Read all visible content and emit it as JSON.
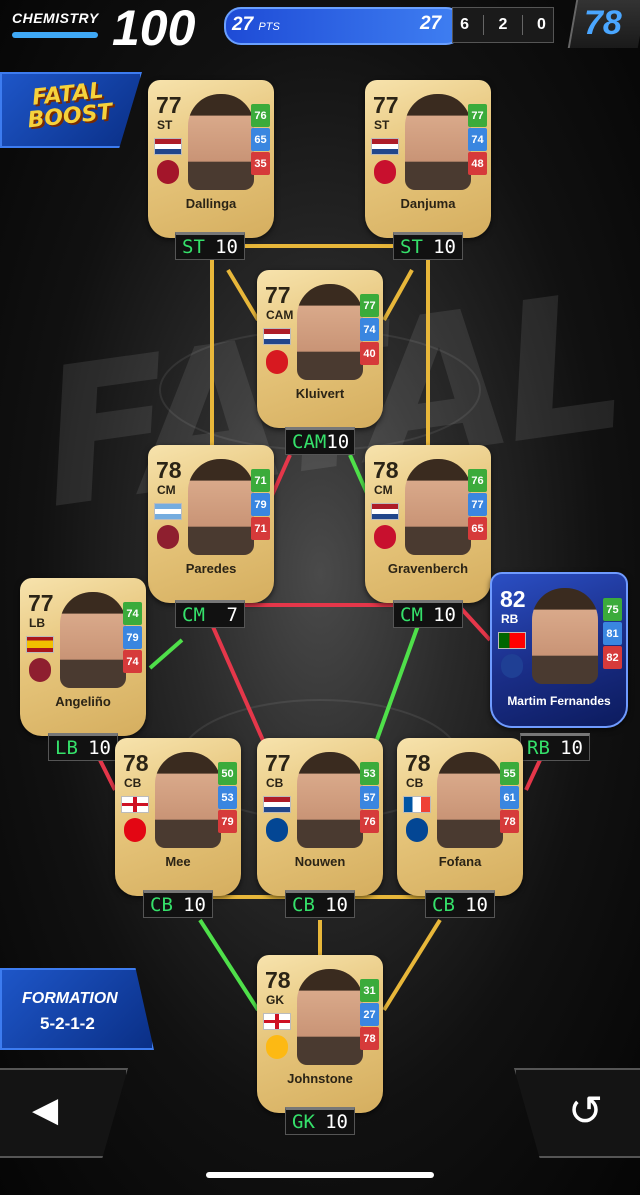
{
  "header": {
    "chemistry_label": "CHEMISTRY",
    "chemistry_value": "100",
    "pts_value": "27",
    "pts_unit": "PTS",
    "pts_right": "27",
    "count_1": "6",
    "count_2": "2",
    "count_3": "0",
    "team_rating": "78"
  },
  "boost": {
    "line1": "FATAL",
    "line2": "BOOST"
  },
  "watermark": "FATAL",
  "players": [
    {
      "id": "dallinga",
      "name": "Dallinga",
      "ovr": "77",
      "pos": "ST",
      "stats": [
        "76",
        "65",
        "35"
      ],
      "stat_colors": [
        "g",
        "b",
        "r"
      ],
      "tag_pos": "ST",
      "tag_chem": "10"
    },
    {
      "id": "danjuma",
      "name": "Danjuma",
      "ovr": "77",
      "pos": "ST",
      "stats": [
        "77",
        "74",
        "48"
      ],
      "stat_colors": [
        "g",
        "b",
        "r"
      ],
      "tag_pos": "ST",
      "tag_chem": "10"
    },
    {
      "id": "kluivert",
      "name": "Kluivert",
      "ovr": "77",
      "pos": "CAM",
      "stats": [
        "77",
        "74",
        "40"
      ],
      "stat_colors": [
        "g",
        "b",
        "r"
      ],
      "tag_pos": "CAM",
      "tag_chem": "10"
    },
    {
      "id": "paredes",
      "name": "Paredes",
      "ovr": "78",
      "pos": "CM",
      "stats": [
        "71",
        "79",
        "71"
      ],
      "stat_colors": [
        "g",
        "b",
        "r"
      ],
      "tag_pos": "CM",
      "tag_chem": "7"
    },
    {
      "id": "gravenberch",
      "name": "Gravenberch",
      "ovr": "78",
      "pos": "CM",
      "stats": [
        "76",
        "77",
        "65"
      ],
      "stat_colors": [
        "g",
        "b",
        "r"
      ],
      "tag_pos": "CM",
      "tag_chem": "10"
    },
    {
      "id": "angelino",
      "name": "Angeliño",
      "ovr": "77",
      "pos": "LB",
      "stats": [
        "74",
        "79",
        "74"
      ],
      "stat_colors": [
        "g",
        "b",
        "r"
      ],
      "tag_pos": "LB",
      "tag_chem": "10"
    },
    {
      "id": "fernandes",
      "name": "Martim Fernandes",
      "ovr": "82",
      "pos": "RB",
      "stats": [
        "75",
        "81",
        "82"
      ],
      "stat_colors": [
        "g",
        "b",
        "r"
      ],
      "tag_pos": "RB",
      "tag_chem": "10"
    },
    {
      "id": "mee",
      "name": "Mee",
      "ovr": "78",
      "pos": "CB",
      "stats": [
        "50",
        "53",
        "79"
      ],
      "stat_colors": [
        "g",
        "b",
        "r"
      ],
      "tag_pos": "CB",
      "tag_chem": "10"
    },
    {
      "id": "nouwen",
      "name": "Nouwen",
      "ovr": "77",
      "pos": "CB",
      "stats": [
        "53",
        "57",
        "76"
      ],
      "stat_colors": [
        "g",
        "b",
        "r"
      ],
      "tag_pos": "CB",
      "tag_chem": "10"
    },
    {
      "id": "fofana",
      "name": "Fofana",
      "ovr": "78",
      "pos": "CB",
      "stats": [
        "55",
        "61",
        "78"
      ],
      "stat_colors": [
        "g",
        "b",
        "r"
      ],
      "tag_pos": "CB",
      "tag_chem": "10"
    },
    {
      "id": "johnstone",
      "name": "Johnstone",
      "ovr": "78",
      "pos": "GK",
      "stats": [
        "31",
        "27",
        "78"
      ],
      "stat_colors": [
        "g",
        "b",
        "r"
      ],
      "tag_pos": "GK",
      "tag_chem": "10"
    }
  ],
  "flags": {
    "dallinga": "netherlands",
    "danjuma": "netherlands",
    "kluivert": "netherlands",
    "paredes": "argentina",
    "gravenberch": "netherlands",
    "angelino": "spain",
    "fernandes": "portugal",
    "mee": "england",
    "nouwen": "netherlands",
    "fofana": "france",
    "johnstone": "england"
  },
  "colors": {
    "link_gold": "#e8b73a",
    "link_green": "#4fe04a",
    "link_red": "#e5374a",
    "accent_blue": "#3f7ff2",
    "card_gold": "#e6c57b"
  },
  "formation": {
    "label": "FORMATION",
    "value": "5-2-1-2"
  },
  "buttons": {
    "back_icon": "back-arrow-icon",
    "reset_icon": "reset-icon"
  }
}
